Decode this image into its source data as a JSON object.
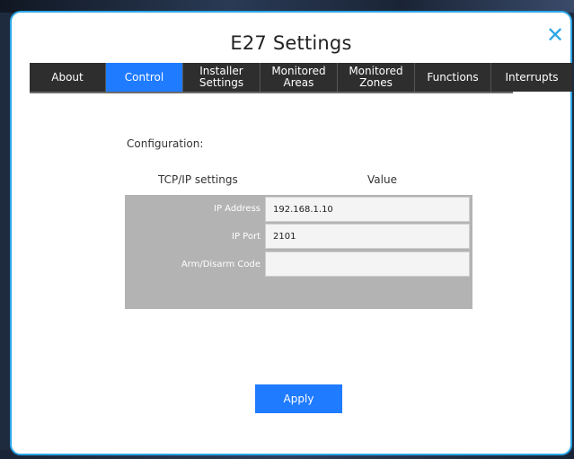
{
  "dialog": {
    "title": "E27 Settings",
    "close_icon": "close-icon"
  },
  "tabs": [
    {
      "label": "About",
      "active": false
    },
    {
      "label": "Control",
      "active": true
    },
    {
      "label": "Installer\nSettings",
      "active": false
    },
    {
      "label": "Monitored\nAreas",
      "active": false
    },
    {
      "label": "Monitored\nZones",
      "active": false
    },
    {
      "label": "Functions",
      "active": false
    },
    {
      "label": "Interrupts",
      "active": false
    }
  ],
  "configuration": {
    "label": "Configuration:",
    "col_setting": "TCP/IP settings",
    "col_value": "Value",
    "rows": [
      {
        "label": "IP Address",
        "value": "192.168.1.10"
      },
      {
        "label": "IP Port",
        "value": "2101"
      },
      {
        "label": "Arm/Disarm Code",
        "value": ""
      }
    ]
  },
  "apply_label": "Apply",
  "colors": {
    "accent": "#1f7bff",
    "dialog_border": "#2ba6e8",
    "tab_bar": "#2e2e2e",
    "table_bg": "#b3b3b3"
  }
}
